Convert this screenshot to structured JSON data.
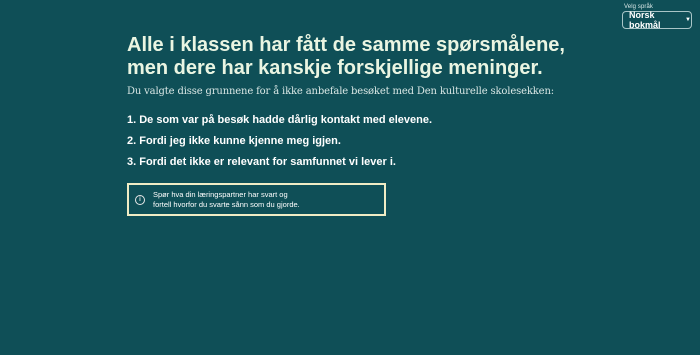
{
  "language": {
    "label": "Velg språk",
    "selected": "Norsk bokmål",
    "chevron": "▼"
  },
  "title_line1": "Alle i klassen har fått de samme spørsmålene,",
  "title_line2": "men dere har kanskje forskjellige meninger.",
  "subtitle": "Du valgte disse grunnene for å ikke anbefale besøket med Den kulturelle skolesekken:",
  "reasons": [
    "1. De som var på besøk hadde dårlig kontakt med elevene.",
    "2. Fordi jeg ikke kunne kjenne meg igjen.",
    "3. Fordi det ikke er relevant for samfunnet vi lever i."
  ],
  "info": {
    "icon": "info-icon",
    "line1": "Spør hva din læringspartner har svart og",
    "line2": "fortell hvorfor du svarte sånn som du gjorde."
  }
}
